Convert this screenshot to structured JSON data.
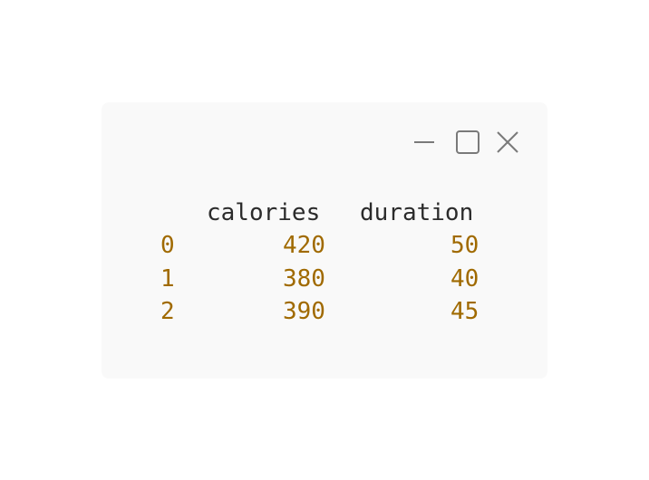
{
  "window": {
    "controls": {
      "minimize_icon": "minimize-icon",
      "maximize_icon": "maximize-icon",
      "close_icon": "close-icon"
    }
  },
  "dataframe": {
    "columns": [
      "calories",
      "duration"
    ],
    "index": [
      "0",
      "1",
      "2"
    ],
    "rows": [
      [
        "420",
        "50"
      ],
      [
        "380",
        "40"
      ],
      [
        "390",
        "45"
      ]
    ]
  },
  "colors": {
    "header_text": "#2b2b2b",
    "value_text": "#a06a00",
    "window_bg": "#f9f9f9",
    "icon_stroke": "#7a7a7a"
  }
}
